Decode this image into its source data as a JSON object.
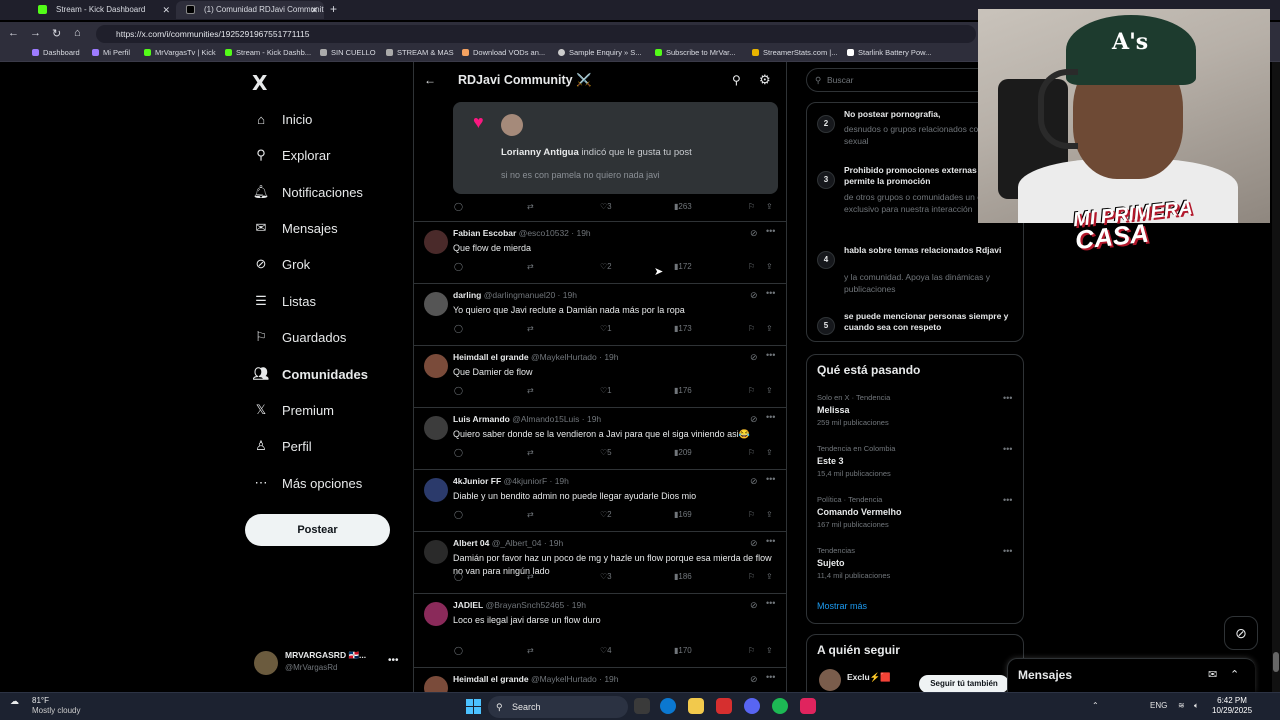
{
  "browser": {
    "tabs": [
      {
        "label": "Stream - Kick Dashboard",
        "color": "#53fc18"
      },
      {
        "label": "(1) Comunidad RDJavi Communit",
        "color": "#000000"
      }
    ],
    "url": "https://x.com/i/communities/1925291967551771115",
    "bookmarks": [
      "Dashboard",
      "Mi Perfil",
      "MrVargasTv | Kick",
      "Stream - Kick Dashb...",
      "SIN CUELLO",
      "STREAM & MAS",
      "Download VODs an...",
      "Sample Enquiry » S...",
      "Subscribe to MrVar...",
      "StreamerStats.com |...",
      "Starlink Battery Pow..."
    ]
  },
  "sidebar": {
    "logo": "X",
    "items": [
      {
        "label": "Inicio",
        "icon": "home-icon"
      },
      {
        "label": "Explorar",
        "icon": "search-icon"
      },
      {
        "label": "Notificaciones",
        "icon": "bell-icon"
      },
      {
        "label": "Mensajes",
        "icon": "envelope-icon"
      },
      {
        "label": "Grok",
        "icon": "grok-icon"
      },
      {
        "label": "Listas",
        "icon": "list-icon"
      },
      {
        "label": "Guardados",
        "icon": "bookmark-icon"
      },
      {
        "label": "Comunidades",
        "icon": "people-icon"
      },
      {
        "label": "Premium",
        "icon": "x-icon"
      },
      {
        "label": "Perfil",
        "icon": "person-icon"
      },
      {
        "label": "Más opciones",
        "icon": "more-circle-icon"
      }
    ],
    "post_button": "Postear",
    "account": {
      "name": "MRVARGASRD 🇩🇴...",
      "handle": "@MrVargasRd"
    }
  },
  "header": {
    "title": "RDJavi Community ⚔️"
  },
  "notification_card": {
    "user": "Lorianny Antigua",
    "action": " indicó que le gusta tu post",
    "text": "si no es con pamela no quiero nada javi"
  },
  "first_actions": {
    "likes": "3",
    "views": "263"
  },
  "tweets": [
    {
      "name": "Fabian Escobar",
      "handle": "@esco10532 · 19h",
      "text": "Que flow de mierda",
      "likes": "2",
      "views": "172",
      "avatar_color": "#4a2a2a"
    },
    {
      "name": "darling",
      "handle": "@darlingmanuel20 · 19h",
      "text": "Yo quiero que Javi reclute a Damián nada más por la ropa",
      "likes": "1",
      "views": "173",
      "avatar_color": "#555555"
    },
    {
      "name": "Heimdall el grande",
      "handle": "@MaykelHurtado · 19h",
      "text": "Que Damier de flow",
      "likes": "1",
      "views": "176",
      "avatar_color": "#7a4b3a"
    },
    {
      "name": "Luis Armando",
      "handle": "@Almando15Luis · 19h",
      "text": "Quiero saber donde se la vendieron a Javi para que el siga viniendo asi😂",
      "likes": "5",
      "views": "209",
      "avatar_color": "#3c3c3c"
    },
    {
      "name": "4kJunior FF",
      "handle": "@4kjuniorF · 19h",
      "text": "Diable y un bendito admin no puede llegar ayudarle Dios mio",
      "likes": "2",
      "views": "169",
      "avatar_color": "#2b3a6b"
    },
    {
      "name": "Albert 04",
      "handle": "@_Albert_04 · 19h",
      "text": "Damián por favor haz un poco de mg y hazle un flow porque esa mierda de flow no van para ningún lado",
      "likes": "3",
      "views": "186",
      "avatar_color": "#2a2a2a"
    },
    {
      "name": "JADIEL",
      "handle": "@BrayanSnch52465 · 19h",
      "text": "Loco es ilegal javi darse un flow duro",
      "likes": "4",
      "views": "170",
      "avatar_color": "#8a2a5a"
    },
    {
      "name": "Heimdall el grande",
      "handle": "@MaykelHurtado · 19h",
      "text": "",
      "likes": "",
      "views": "",
      "avatar_color": "#7a4b3a"
    }
  ],
  "right": {
    "search_placeholder": "Buscar",
    "rules": [
      {
        "num": "2",
        "title": "No postear pornografia,",
        "desc": "desnudos o grupos relacionados contenido sexual"
      },
      {
        "num": "3",
        "title": "Prohibido promociones externas se permite la promoción",
        "desc": "de otros grupos o comunidades un espacio exclusivo para nuestra interacción"
      },
      {
        "num": "4",
        "title": "habla sobre temas relacionados Rdjavi",
        "desc": "y la comunidad. Apoya las dinámicas y publicaciones"
      },
      {
        "num": "5",
        "title": "se puede mencionar personas siempre y cuando sea con respeto",
        "desc": ""
      }
    ],
    "trends_title": "Qué está pasando",
    "trends": [
      {
        "context": "Solo en X · Tendencia",
        "name": "Melissa",
        "posts": "259 mil publicaciones"
      },
      {
        "context": "Tendencia en Colombia",
        "name": "Este 3",
        "posts": "15,4 mil publicaciones"
      },
      {
        "context": "Política · Tendencia",
        "name": "Comando Vermelho",
        "posts": "167 mil publicaciones"
      },
      {
        "context": "Tendencias",
        "name": "Sujeto",
        "posts": "11,4 mil publicaciones"
      }
    ],
    "show_more": "Mostrar más",
    "follow_title": "A quién seguir",
    "follow_name": "Exclu⚡🟥",
    "follow_button": "Seguir tú también"
  },
  "messages_dock": {
    "title": "Mensajes"
  },
  "overlay": {
    "logo_line1": "MI PRIMERA",
    "logo_line2": "CASA"
  },
  "taskbar": {
    "temp": "81°F",
    "condition": "Mostly cloudy",
    "search": "Search",
    "lang": "ENG",
    "time": "6:42 PM",
    "date": "10/29/2025"
  }
}
